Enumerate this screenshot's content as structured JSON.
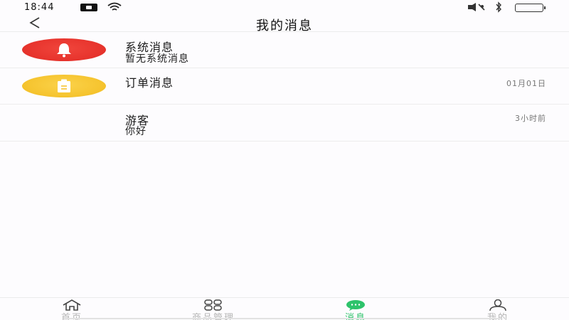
{
  "status_bar": {
    "time": "18:44",
    "battery_color": "#f2d12c"
  },
  "nav": {
    "title": "我的消息",
    "back_icon": "chevron-left-icon"
  },
  "messages": [
    {
      "title": "系统消息",
      "preview": "暂无系统消息",
      "time": "",
      "icon": "bell-icon",
      "icon_color": "#e8352e"
    },
    {
      "title": "订单消息",
      "preview": "",
      "time": "01月01日",
      "icon": "clipboard-icon",
      "icon_color": "#f6c531"
    },
    {
      "title": "游客",
      "preview": "你好",
      "time": "3小时前",
      "icon": "",
      "icon_color": ""
    }
  ],
  "tabs": [
    {
      "label": "首页",
      "icon": "home-icon",
      "active": false
    },
    {
      "label": "商品管理",
      "icon": "grid-icon",
      "active": false
    },
    {
      "label": "消息",
      "icon": "chat-icon",
      "active": true
    },
    {
      "label": "我的",
      "icon": "user-icon",
      "active": false
    }
  ],
  "colors": {
    "accent": "#2ec36b",
    "inactive_tab": "#b5b5b5"
  }
}
